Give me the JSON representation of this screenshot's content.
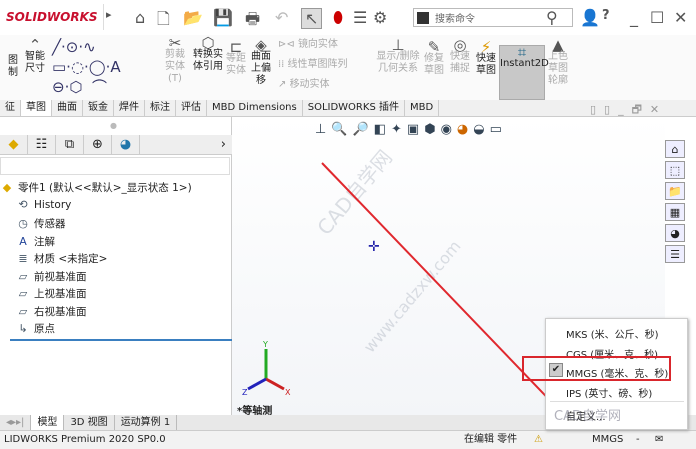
{
  "app": {
    "logo": "SOLIDWORKS",
    "search_placeholder": "搜索命令",
    "help": "?"
  },
  "ribbon": {
    "items": [
      "图制",
      "智能尺寸",
      "剪裁实体(T)",
      "转换实体引用",
      "等距实体",
      "曲面上偏移",
      "镜向实体",
      "线性草图阵列",
      "移动实体",
      "显示/删除几何关系",
      "修复草图",
      "快速捕捉",
      "快速草图",
      "Instant2D",
      "上色草图轮廓"
    ]
  },
  "tabs": [
    "征",
    "草图",
    "曲面",
    "钣金",
    "焊件",
    "标注",
    "评估",
    "MBD Dimensions",
    "SOLIDWORKS 插件",
    "MBD"
  ],
  "tree": {
    "root": "零件1 (默认<<默认>_显示状态 1>)",
    "items": [
      "History",
      "传感器",
      "注解",
      "材质 <未指定>",
      "前视基准面",
      "上视基准面",
      "右视基准面",
      "原点"
    ]
  },
  "view": {
    "orientation": "*等轴测",
    "axes": [
      "X",
      "Y",
      "Z"
    ],
    "watermark": "CAD自学网",
    "watermark2": "www.cadzxw.com"
  },
  "bottom_tabs": [
    "模型",
    "3D 视图",
    "运动算例 1"
  ],
  "status": {
    "product": "LIDWORKS Premium 2020 SP0.0",
    "mode": "在编辑 零件",
    "units": "MMGS",
    "units_arrow": "-"
  },
  "units_menu": {
    "items": [
      "MKS (米、公斤、秒)",
      "CGS (厘米、克、秒)",
      "MMGS (毫米、克、秒)",
      "IPS (英寸、磅、秒)",
      "自定义..."
    ],
    "selected": "MMGS (毫米、克、秒)",
    "watermark": "CAD自学网"
  },
  "colors": {
    "accent": "#c8102e",
    "highlight": "#d9262c"
  }
}
